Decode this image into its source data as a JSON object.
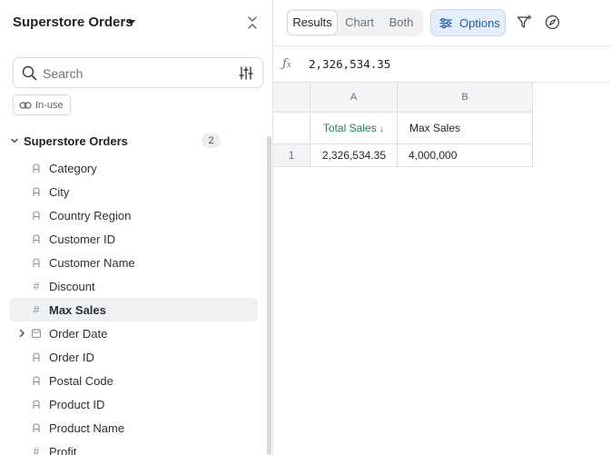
{
  "sidebar": {
    "title": "Superstore Orders",
    "search_placeholder": "Search",
    "inuse_label": "In-use",
    "group": {
      "label": "Superstore Orders",
      "count": "2"
    },
    "fields": [
      {
        "label": "Category",
        "type": "text"
      },
      {
        "label": "City",
        "type": "text"
      },
      {
        "label": "Country Region",
        "type": "text"
      },
      {
        "label": "Customer ID",
        "type": "text"
      },
      {
        "label": "Customer Name",
        "type": "text"
      },
      {
        "label": "Discount",
        "type": "number"
      },
      {
        "label": "Max Sales",
        "type": "number"
      },
      {
        "label": "Order Date",
        "type": "date"
      },
      {
        "label": "Order ID",
        "type": "text"
      },
      {
        "label": "Postal Code",
        "type": "text"
      },
      {
        "label": "Product ID",
        "type": "text"
      },
      {
        "label": "Product Name",
        "type": "text"
      },
      {
        "label": "Profit",
        "type": "number"
      }
    ],
    "selected_field": "Max Sales"
  },
  "toolbar": {
    "tabs": [
      "Results",
      "Chart",
      "Both"
    ],
    "active_tab": "Results",
    "options_label": "Options"
  },
  "formula": {
    "value": "2,326,534.35"
  },
  "grid": {
    "column_letters": [
      "A",
      "B"
    ],
    "headers": [
      "Total Sales",
      "Max Sales"
    ],
    "sort_indicator": "↓",
    "rows": [
      {
        "num": "1",
        "cells": [
          "2,326,534.35",
          "4,000,000"
        ]
      }
    ]
  },
  "colors": {
    "accent_blue": "#1f5fa8",
    "options_bg": "#e4eefb",
    "sorted_header_green": "#1a7f5a",
    "selected_row_bg": "#f0f1f3"
  },
  "icons": {
    "collapse": "chevrons-collapse-icon",
    "search": "search-icon",
    "filter": "sliders-icon",
    "inuse": "link-icon",
    "options": "sliders-icon",
    "tool1": "filter-sparkle-icon",
    "tool2": "compass-icon",
    "fx": "function-icon"
  }
}
